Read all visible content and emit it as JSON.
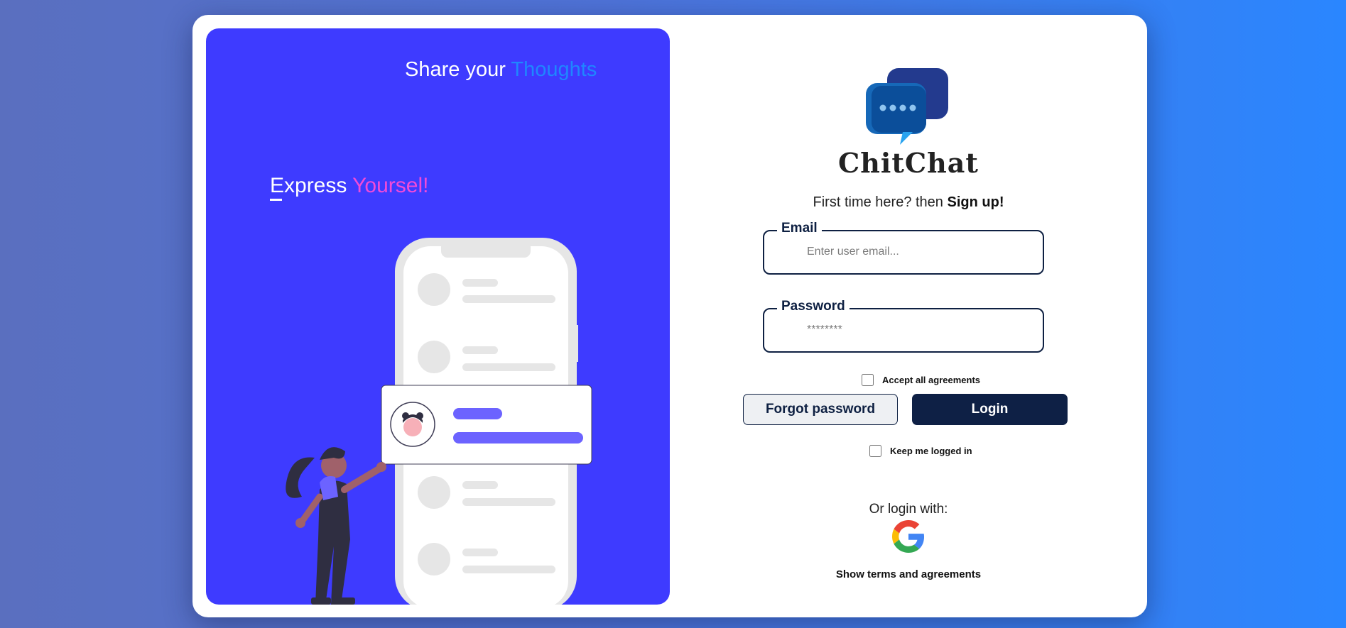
{
  "hero": {
    "headline_prefix": "Share your",
    "headline_accent": "Thoughts",
    "subline_prefix": "Express",
    "subline_accent": "Yoursel!"
  },
  "brand": {
    "name": "ChitChat",
    "logo_icon": "chat-bubbles-icon"
  },
  "signup": {
    "prefix": "First time here? then",
    "link": "Sign up!"
  },
  "form": {
    "email_label": "Email",
    "email_placeholder": "Enter user email...",
    "email_value": "",
    "password_label": "Password",
    "password_placeholder": "********",
    "password_value": "",
    "accept_label": "Accept all agreements",
    "accept_checked": false,
    "forgot_label": "Forgot password",
    "login_label": "Login",
    "keep_label": "Keep me logged in",
    "keep_checked": false
  },
  "social": {
    "or_label": "Or login with:",
    "google_icon": "google-icon"
  },
  "footer": {
    "terms_label": "Show terms and agreements"
  },
  "colors": {
    "panel": "#3e3bff",
    "accent_blue": "#1f87ff",
    "accent_pink": "#f24bd8",
    "navy": "#0e2045"
  }
}
